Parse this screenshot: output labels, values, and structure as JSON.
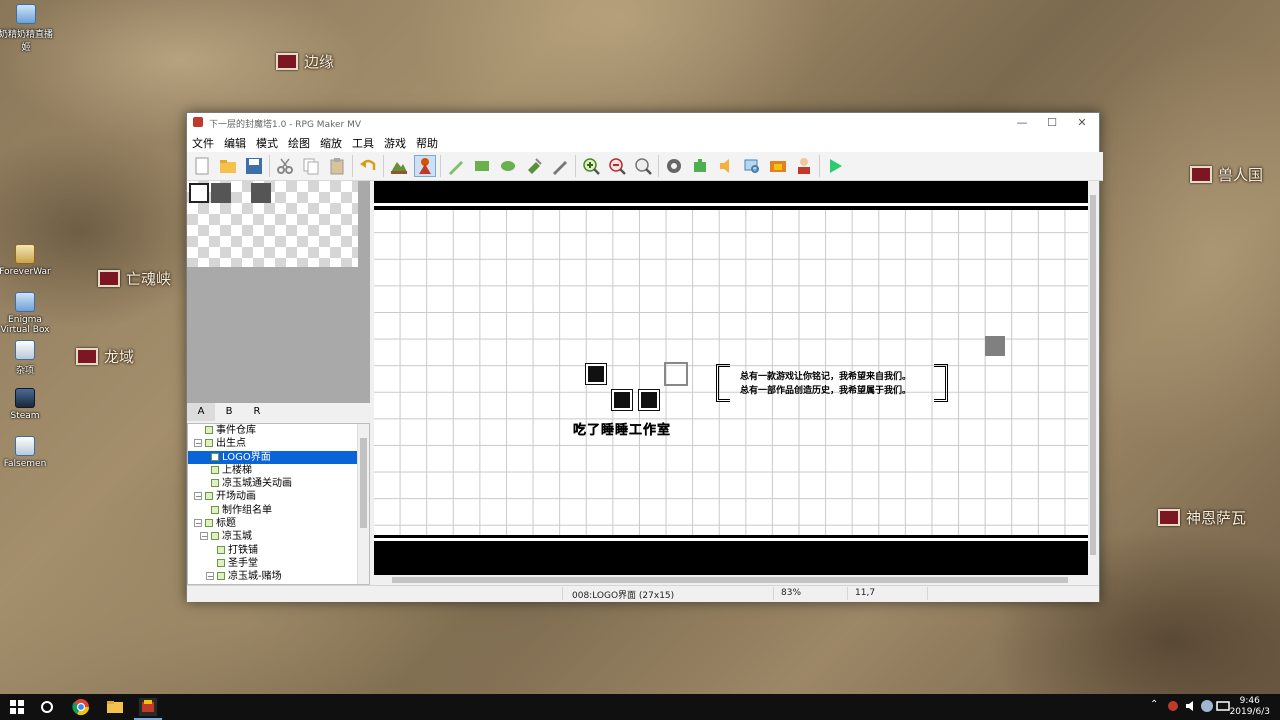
{
  "desktop": {
    "map_labels": [
      "边缘",
      "亡魂峡",
      "龙域",
      "兽人国",
      "神恩萨瓦"
    ],
    "icons": [
      "奶精奶精直播姬",
      "ForeverWar",
      "Enigma Virtual Box",
      "杂项",
      "Steam",
      "Falsemen"
    ]
  },
  "window": {
    "title": "下一层的封魔塔1.0 - RPG Maker MV",
    "controls": {
      "minimize": "—",
      "maximize": "☐",
      "close": "✕"
    }
  },
  "menu": [
    "文件",
    "编辑",
    "模式",
    "绘图",
    "缩放",
    "工具",
    "游戏",
    "帮助"
  ],
  "toolbar": [
    "new-project",
    "open-project",
    "save-project",
    "|",
    "cut",
    "copy",
    "paste",
    "|",
    "undo",
    "|",
    "map-mode",
    "event-mode",
    "|",
    "pencil",
    "rectangle",
    "ellipse",
    "fill",
    "shadow-pen",
    "|",
    "zoom-in",
    "zoom-out",
    "zoom-actual",
    "|",
    "database",
    "plugin-manager",
    "sound-test",
    "event-searcher",
    "resource-manager",
    "character-generator",
    "|",
    "playtest"
  ],
  "tileset_tabs": [
    "A",
    "B",
    "R"
  ],
  "map_tree": [
    {
      "label": "事件仓库",
      "level": 1,
      "expander": "",
      "selected": false
    },
    {
      "label": "出生点",
      "level": 1,
      "expander": "⊟",
      "selected": false
    },
    {
      "label": "LOGO界面",
      "level": 2,
      "expander": "",
      "selected": true
    },
    {
      "label": "上楼梯",
      "level": 2,
      "expander": "",
      "selected": false
    },
    {
      "label": "凉玉城通关动画",
      "level": 2,
      "expander": "",
      "selected": false
    },
    {
      "label": "开场动画",
      "level": 1,
      "expander": "⊟",
      "selected": false
    },
    {
      "label": "制作组名单",
      "level": 2,
      "expander": "",
      "selected": false
    },
    {
      "label": "标题",
      "level": 1,
      "expander": "⊟",
      "selected": false
    },
    {
      "label": "凉玉城",
      "level": 2,
      "expander": "⊟",
      "selected": false
    },
    {
      "label": "打铁铺",
      "level": 3,
      "expander": "",
      "selected": false
    },
    {
      "label": "圣手堂",
      "level": 3,
      "expander": "",
      "selected": false
    },
    {
      "label": "凉玉城-赌场",
      "level": 3,
      "expander": "⊟",
      "selected": false
    }
  ],
  "map": {
    "logo_text": "吃了睡睡工作室",
    "quote_line1": "总有一款游戏让你铭记，我希望来自我们。",
    "quote_line2": "总有一部作品创造历史，我希望属于我们。"
  },
  "status": {
    "map_info": "008:LOGO界面 (27x15)",
    "zoom": "83%",
    "coords": "11,7"
  },
  "taskbar": {
    "time": "9:46",
    "date": "2019/6/3"
  }
}
